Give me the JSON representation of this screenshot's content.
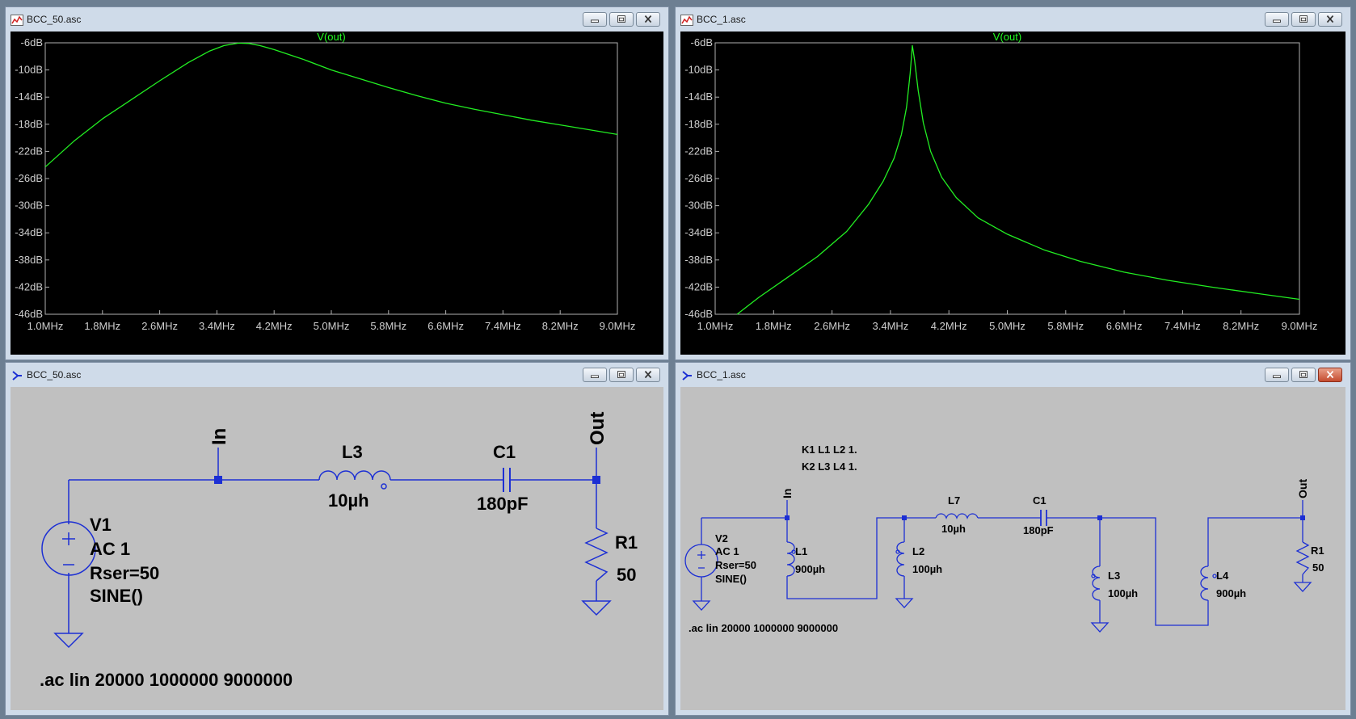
{
  "windows": [
    {
      "title": "BCC_50.asc",
      "kind": "waveform"
    },
    {
      "title": "BCC_1.asc",
      "kind": "waveform"
    },
    {
      "title": "BCC_50.asc",
      "kind": "schematic"
    },
    {
      "title": "BCC_1.asc",
      "kind": "schematic"
    }
  ],
  "colors": {
    "trace": "#22ee22",
    "wire": "#1c2fd4",
    "plot_bg": "#000000",
    "schematic_bg": "#c0c0c0"
  },
  "chart_data": [
    {
      "type": "line",
      "title": "V(out)",
      "xlabel": "",
      "ylabel": "",
      "xlim": [
        1.0,
        9.0
      ],
      "ylim": [
        -46,
        -6
      ],
      "x_ticks": [
        "1.0MHz",
        "1.8MHz",
        "2.6MHz",
        "3.4MHz",
        "4.2MHz",
        "5.0MHz",
        "5.8MHz",
        "6.6MHz",
        "7.4MHz",
        "8.2MHz",
        "9.0MHz"
      ],
      "y_ticks": [
        "-6dB",
        "-10dB",
        "-14dB",
        "-18dB",
        "-22dB",
        "-26dB",
        "-30dB",
        "-34dB",
        "-38dB",
        "-42dB",
        "-46dB"
      ],
      "grid": false,
      "series": [
        {
          "name": "V(out)",
          "x": [
            1.0,
            1.4,
            1.8,
            2.2,
            2.6,
            3.0,
            3.3,
            3.5,
            3.7,
            3.85,
            4.0,
            4.2,
            4.6,
            5.0,
            5.4,
            5.8,
            6.2,
            6.6,
            7.0,
            7.4,
            7.8,
            8.2,
            8.6,
            9.0
          ],
          "y": [
            -24.3,
            -20.5,
            -17.2,
            -14.4,
            -11.6,
            -8.9,
            -7.2,
            -6.4,
            -6.05,
            -6.1,
            -6.4,
            -7.0,
            -8.4,
            -10.0,
            -11.3,
            -12.6,
            -13.8,
            -14.9,
            -15.8,
            -16.6,
            -17.4,
            -18.1,
            -18.8,
            -19.5
          ]
        }
      ]
    },
    {
      "type": "line",
      "title": "V(out)",
      "xlabel": "",
      "ylabel": "",
      "xlim": [
        1.0,
        9.0
      ],
      "ylim": [
        -46,
        -6
      ],
      "x_ticks": [
        "1.0MHz",
        "1.8MHz",
        "2.6MHz",
        "3.4MHz",
        "4.2MHz",
        "5.0MHz",
        "5.8MHz",
        "6.6MHz",
        "7.4MHz",
        "8.2MHz",
        "9.0MHz"
      ],
      "y_ticks": [
        "-6dB",
        "-10dB",
        "-14dB",
        "-18dB",
        "-22dB",
        "-26dB",
        "-30dB",
        "-34dB",
        "-38dB",
        "-42dB",
        "-46dB"
      ],
      "grid": false,
      "series": [
        {
          "name": "V(out)",
          "x": [
            1.3,
            1.6,
            2.0,
            2.4,
            2.8,
            3.1,
            3.3,
            3.45,
            3.55,
            3.62,
            3.67,
            3.7,
            3.73,
            3.78,
            3.85,
            3.95,
            4.1,
            4.3,
            4.6,
            5.0,
            5.5,
            6.0,
            6.6,
            7.2,
            7.8,
            8.4,
            9.0
          ],
          "y": [
            -46,
            -43.5,
            -40.5,
            -37.5,
            -33.8,
            -29.8,
            -26.4,
            -23.0,
            -19.5,
            -15.5,
            -10.5,
            -6.4,
            -8.5,
            -13.0,
            -17.8,
            -22.0,
            -25.8,
            -28.8,
            -31.8,
            -34.2,
            -36.5,
            -38.2,
            -39.8,
            -41.0,
            -42.0,
            -42.9,
            -43.8
          ]
        }
      ]
    }
  ],
  "schematic_50": {
    "net_in": "In",
    "net_out": "Out",
    "l3_name": "L3",
    "l3_value": "10µh",
    "c1_name": "C1",
    "c1_value": "180pF",
    "r1_name": "R1",
    "r1_value": "50",
    "v1_name": "V1",
    "v1_line1": "AC 1",
    "v1_line2": "Rser=50",
    "v1_line3": "SINE()",
    "directive": ".ac lin 20000 1000000 9000000"
  },
  "schematic_1": {
    "k1": "K1 L1 L2  1.",
    "k2": "K2 L3 L4 1.",
    "net_in": "In",
    "net_out": "Out",
    "v2_name": "V2",
    "v2_line1": "AC 1",
    "v2_line2": "Rser=50",
    "v2_line3": "SINE()",
    "l1_name": "L1",
    "l1_value": "900µh",
    "l2_name": "L2",
    "l2_value": "100µh",
    "l7_name": "L7",
    "l7_value": "10µh",
    "c1_name": "C1",
    "c1_value": "180pF",
    "l3_name": "L3",
    "l3_value": "100µh",
    "l4_name": "L4",
    "l4_value": "900µh",
    "r1_name": "R1",
    "r1_value": "50",
    "directive": ".ac lin 20000 1000000 9000000"
  }
}
